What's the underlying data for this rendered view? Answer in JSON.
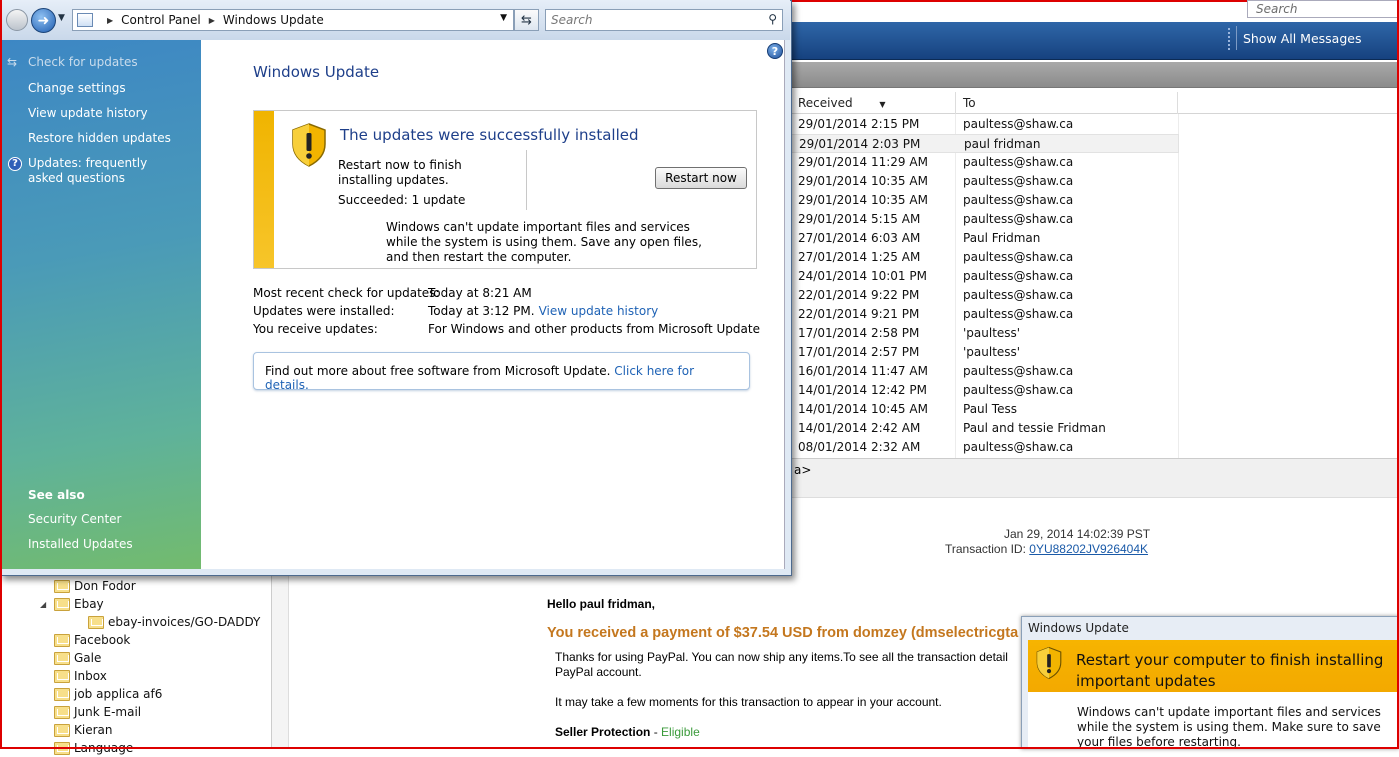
{
  "background": {
    "search_placeholder": "Search",
    "show_all": "Show All Messages",
    "columns": {
      "received": "Received",
      "to": "To"
    },
    "sort_indicator": "▼",
    "messages": [
      {
        "received": "29/01/2014 2:15 PM",
        "to": "paultess@shaw.ca"
      },
      {
        "received": "29/01/2014 2:03 PM",
        "to": "paul fridman"
      },
      {
        "received": "29/01/2014 11:29 AM",
        "to": "paultess@shaw.ca"
      },
      {
        "received": "29/01/2014 10:35 AM",
        "to": "paultess@shaw.ca"
      },
      {
        "received": "29/01/2014 10:35 AM",
        "to": "paultess@shaw.ca"
      },
      {
        "received": "29/01/2014 5:15 AM",
        "to": "paultess@shaw.ca"
      },
      {
        "received": "27/01/2014 6:03 AM",
        "to": "Paul Fridman"
      },
      {
        "received": "27/01/2014 1:25 AM",
        "to": "paultess@shaw.ca"
      },
      {
        "received": "24/01/2014 10:01 PM",
        "to": "paultess@shaw.ca"
      },
      {
        "received": "22/01/2014 9:22 PM",
        "to": "paultess@shaw.ca"
      },
      {
        "received": "22/01/2014 9:21 PM",
        "to": "paultess@shaw.ca"
      },
      {
        "received": "17/01/2014 2:58 PM",
        "to": "'paultess'"
      },
      {
        "received": "17/01/2014 2:57 PM",
        "to": "'paultess'"
      },
      {
        "received": "16/01/2014 11:47 AM",
        "to": "paultess@shaw.ca"
      },
      {
        "received": "14/01/2014 12:42 PM",
        "to": "paultess@shaw.ca"
      },
      {
        "received": "14/01/2014 10:45 AM",
        "to": "Paul Tess"
      },
      {
        "received": "14/01/2014 2:42 AM",
        "to": "Paul and tessie Fridman"
      },
      {
        "received": "08/01/2014 2:32 AM",
        "to": "paultess@shaw.ca"
      }
    ],
    "preview_header": "a>",
    "folders": [
      "Don Fodor",
      "Ebay",
      "ebay-invoices/GO-DADDY",
      "Facebook",
      "Gale",
      "Inbox",
      "job applica af6",
      "Junk E-mail",
      "Kieran",
      "Language"
    ],
    "email": {
      "date": "Jan 29, 2014 14:02:39 PST",
      "txid_label": "Transaction ID: ",
      "txid": "0YU88202JV926404K",
      "hello": "Hello paul fridman,",
      "payment": "You received a payment of $37.54 USD from domzey (dmselectricgta",
      "thanks": "Thanks for using PayPal. You can now ship any items.To see all the transaction detail PayPal account.",
      "moments": "It may take a few moments for this transaction to appear in your account.",
      "seller_label": "Seller Protection",
      "seller_sep": " - ",
      "seller_value": "Eligible"
    }
  },
  "window": {
    "breadcrumb": [
      "Control Panel",
      "Windows Update"
    ],
    "search_placeholder": "Search",
    "sidebar": {
      "check": "Check for updates",
      "change": "Change settings",
      "history": "View update history",
      "restore": "Restore hidden updates",
      "faq": "Updates: frequently asked questions",
      "see_also": "See also",
      "security": "Security Center",
      "installed": "Installed Updates"
    },
    "title": "Windows Update",
    "status": {
      "title": "The updates were successfully installed",
      "restart_text": "Restart now to finish installing updates.",
      "succeeded": "Succeeded: 1 update",
      "restart_button": "Restart now",
      "warning": "Windows can't update important files and services while the system is using them. Save any open files, and then restart the computer."
    },
    "info": {
      "recent_label": "Most recent check for updates:",
      "recent_value": "Today at 8:21 AM",
      "installed_label": "Updates were installed:",
      "installed_value": "Today at 3:12 PM.",
      "installed_link": "View update history",
      "receive_label": "You receive updates:",
      "receive_value": "For Windows and other products from Microsoft Update"
    },
    "findout": {
      "text": "Find out more about free software from Microsoft Update. ",
      "link": "Click here for details."
    }
  },
  "toast": {
    "title": "Windows Update",
    "heading": "Restart your computer to finish installing important updates",
    "body": "Windows can't update important files and services while the system is using them. Make sure to save your files before restarting."
  },
  "colors": {
    "accent_blue": "#1e3f8a",
    "warning_yellow": "#f0b400",
    "link": "#1e62b5",
    "paypal_orange": "#c4771e"
  }
}
